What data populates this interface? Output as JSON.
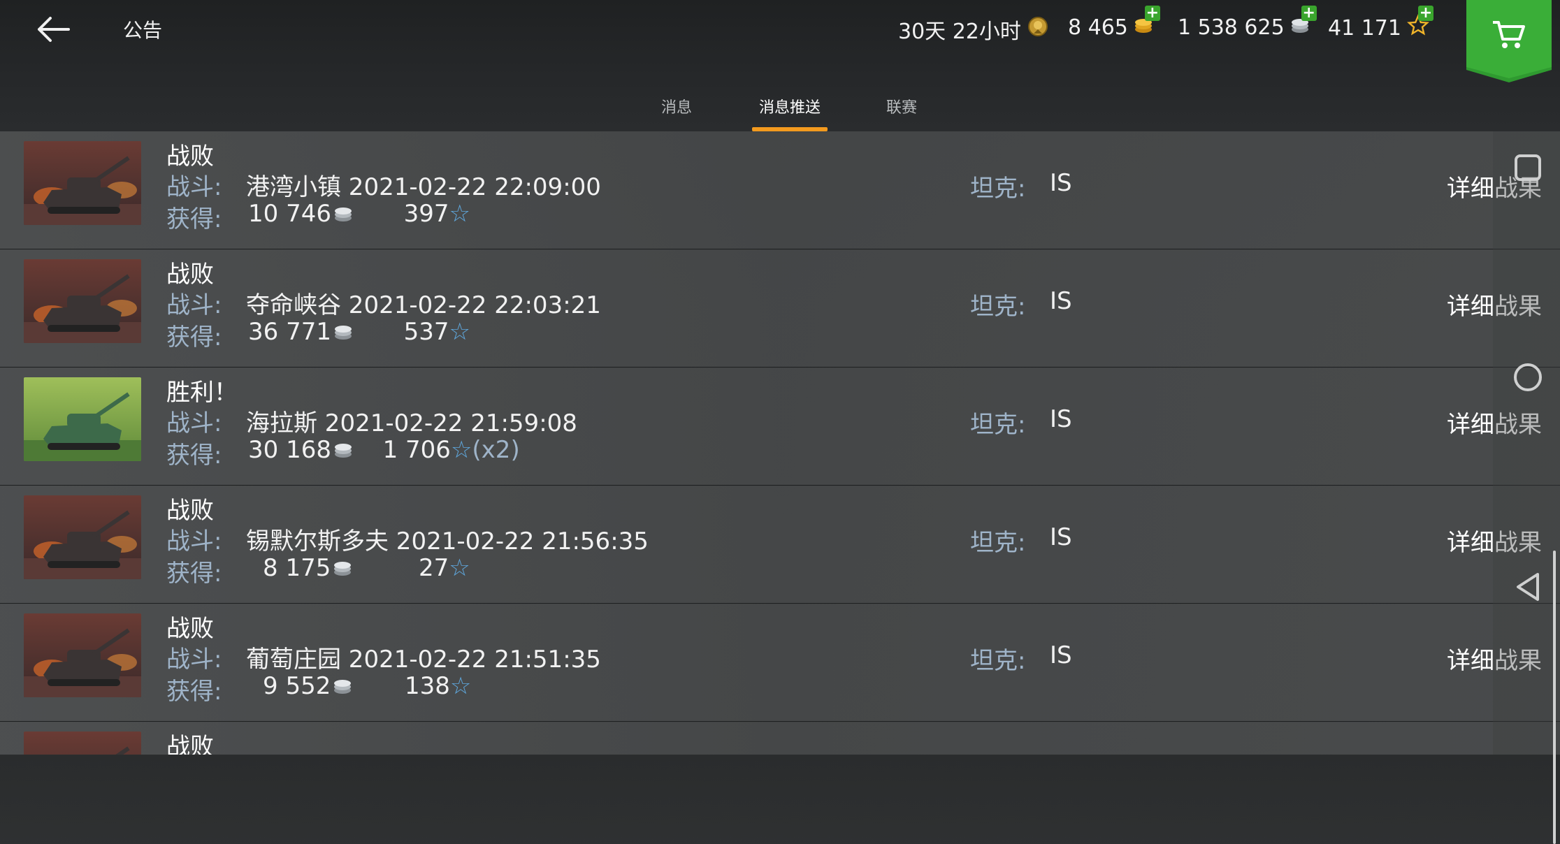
{
  "header": {
    "title": "公告",
    "premium_time": "30天 22小时",
    "gold": "8 465",
    "credits": "1 538 625",
    "free_xp": "41 171"
  },
  "tabs": [
    {
      "label": "消息",
      "active": false
    },
    {
      "label": "消息推送",
      "active": true
    },
    {
      "label": "联赛",
      "active": false
    }
  ],
  "labels": {
    "battle": "战斗:",
    "earned": "获得:",
    "tank": "坦克:",
    "detail": "详细战果"
  },
  "battles": [
    {
      "result": "战败",
      "thumb": "defeat",
      "map_time": "港湾小镇 2021-02-22 22:09:00",
      "credits": "10 746",
      "xp": "397",
      "mult": "",
      "tank": "IS"
    },
    {
      "result": "战败",
      "thumb": "defeat",
      "map_time": "夺命峡谷 2021-02-22 22:03:21",
      "credits": "36 771",
      "xp": "537",
      "mult": "",
      "tank": "IS"
    },
    {
      "result": "胜利！",
      "thumb": "victory",
      "map_time": "海拉斯 2021-02-22 21:59:08",
      "credits": "30 168",
      "xp": "1 706",
      "mult": "(x2)",
      "tank": "IS"
    },
    {
      "result": "战败",
      "thumb": "defeat",
      "map_time": "锡默尔斯多夫 2021-02-22 21:56:35",
      "credits": "8 175",
      "xp": "27",
      "mult": "",
      "tank": "IS"
    },
    {
      "result": "战败",
      "thumb": "defeat",
      "map_time": "葡萄庄园 2021-02-22 21:51:35",
      "credits": "9 552",
      "xp": "138",
      "mult": "",
      "tank": "IS"
    },
    {
      "result": "战败",
      "thumb": "defeat",
      "map_time": "",
      "credits": "",
      "xp": "",
      "mult": "",
      "tank": ""
    }
  ],
  "icons": {
    "back": "arrow-left-icon",
    "premium": "premium-badge-icon",
    "gold": "gold-coin-icon",
    "credits": "silver-coin-icon",
    "xp": "star-icon",
    "cart": "shopping-cart-icon"
  },
  "colors": {
    "accent": "#f39a1e",
    "label": "#9fb4c9",
    "star": "#5fa8de",
    "plus": "#3aa52d",
    "cart": "#2f9a30"
  }
}
